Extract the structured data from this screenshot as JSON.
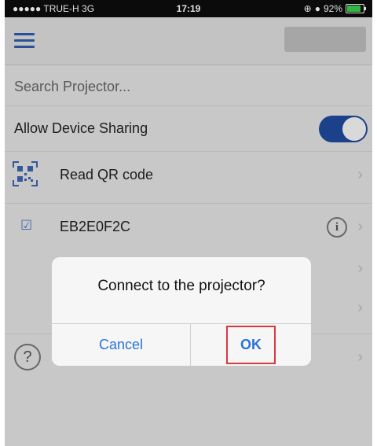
{
  "status_bar": {
    "carrier": "●●●●● TRUE-H  3G",
    "time": "17:19",
    "battery": "92%",
    "battery_level": 0.92
  },
  "nav": {
    "menu_icon": "hamburger-menu-icon"
  },
  "search": {
    "placeholder": "Search Projector..."
  },
  "device_sharing": {
    "label": "Allow Device Sharing",
    "enabled": true
  },
  "qr_row": {
    "label": "Read QR code",
    "icon": "qr-code-icon"
  },
  "projector_row": {
    "label": "EB2E0F2C",
    "checked": true,
    "icon": "info-icon"
  },
  "help_row": {
    "icon": "help-icon"
  },
  "dialog": {
    "message": "Connect to the projector?",
    "cancel_label": "Cancel",
    "ok_label": "OK"
  },
  "colors": {
    "accent": "#2b73d6",
    "toggle_on": "#1f4b9e",
    "highlight": "#d9383f"
  }
}
